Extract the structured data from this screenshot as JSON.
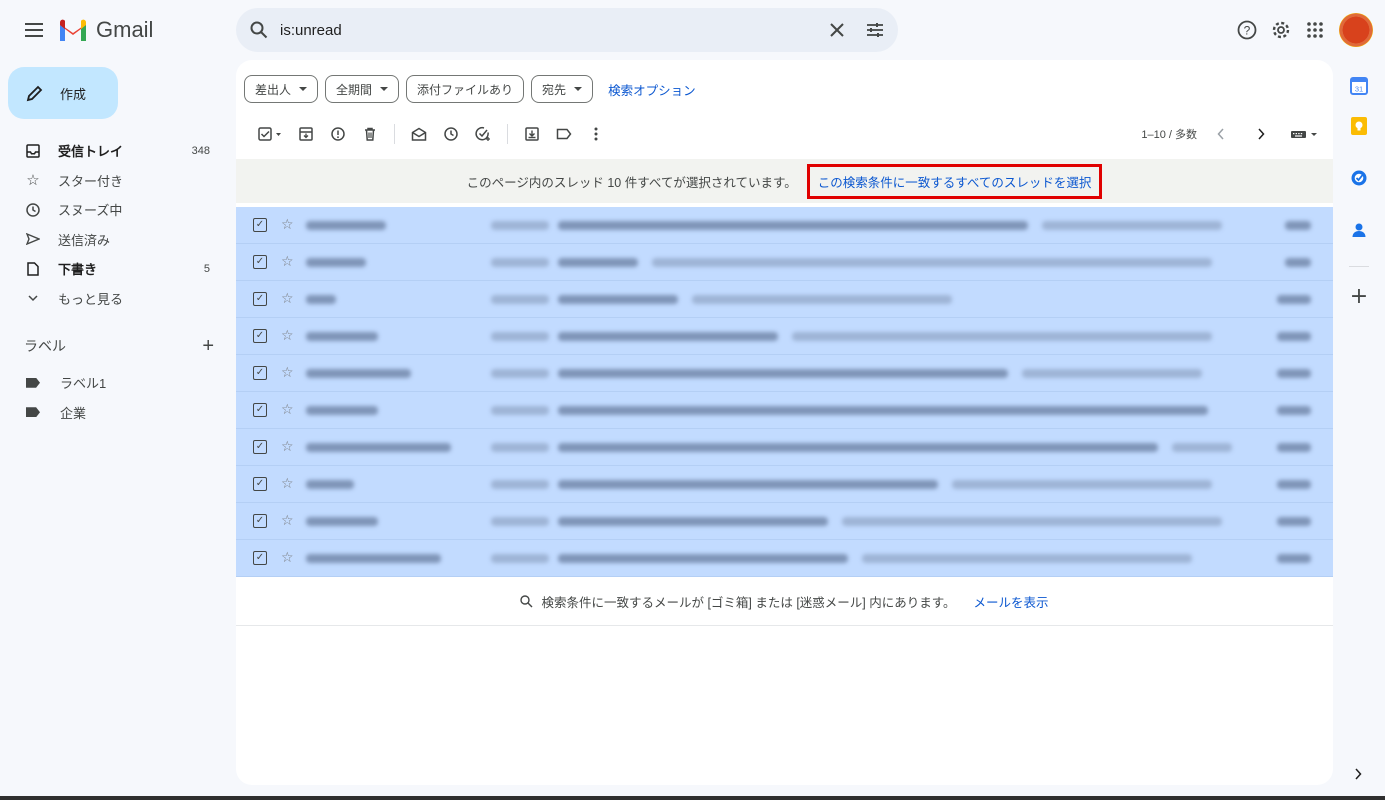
{
  "app": {
    "name": "Gmail",
    "search_query": "is:unread"
  },
  "sidebar": {
    "compose_label": "作成",
    "items": [
      {
        "icon": "inbox-icon",
        "label": "受信トレイ",
        "count": "348",
        "bold": true
      },
      {
        "icon": "star-icon",
        "label": "スター付き",
        "count": "",
        "bold": false
      },
      {
        "icon": "clock-icon",
        "label": "スヌーズ中",
        "count": "",
        "bold": false
      },
      {
        "icon": "send-icon",
        "label": "送信済み",
        "count": "",
        "bold": false
      },
      {
        "icon": "draft-icon",
        "label": "下書き",
        "count": "5",
        "bold": true
      },
      {
        "icon": "chevron-down-icon",
        "label": "もっと見る",
        "count": "",
        "bold": false
      }
    ],
    "labels_heading": "ラベル",
    "labels": [
      {
        "label": "ラベル1"
      },
      {
        "label": "企業"
      }
    ]
  },
  "filters": {
    "chips": [
      {
        "label": "差出人",
        "dropdown": true
      },
      {
        "label": "全期間",
        "dropdown": true
      },
      {
        "label": "添付ファイルあり",
        "dropdown": false
      },
      {
        "label": "宛先",
        "dropdown": true
      }
    ],
    "advanced_link": "検索オプション"
  },
  "toolbar": {
    "pagination": "1–10 / 多数"
  },
  "banner": {
    "text": "このページ内のスレッド 10 件すべてが選択されています。",
    "link": "この検索条件に一致するすべてのスレッドを選択"
  },
  "rows": {
    "count": 10,
    "selected": true,
    "content_blurred": true
  },
  "footer_note": {
    "text": "検索条件に一致するメールが [ゴミ箱] または [迷惑メール] 内にあります。",
    "link": "メールを表示"
  },
  "colors": {
    "accent": "#0b57d0",
    "compose_bg": "#c2e7ff",
    "selected_row": "#c2dbff",
    "highlight_border": "#e00000"
  }
}
